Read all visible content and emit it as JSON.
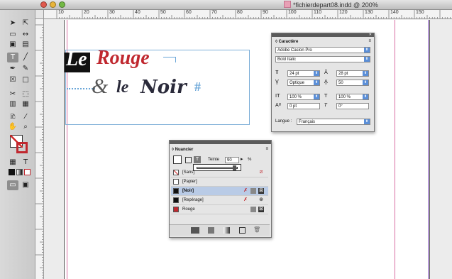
{
  "window": {
    "title": "*fichierdepart08.indd @ 200%"
  },
  "ruler": {
    "top_labels": [
      "10",
      "20",
      "30",
      "40",
      "50",
      "60",
      "70",
      "80",
      "90",
      "100",
      "110",
      "120",
      "130",
      "140",
      "150"
    ]
  },
  "document": {
    "word1": "Le",
    "word2": "Rouge",
    "word3": "&",
    "word4": "le",
    "word5": "Noir",
    "end_marker": "#",
    "red": "#c0282f",
    "dark": "#2a2a3a"
  },
  "caractere_panel": {
    "tab": "◊ Caractère",
    "font_family": "Adobe Caslon Pro",
    "font_style": "Bold Italic",
    "size": "24 pt",
    "leading": "28 pt",
    "kerning": "Optique",
    "tracking": "50",
    "vscale": "100 %",
    "hscale": "100 %",
    "baseline": "0 pt",
    "skew": "0°",
    "language_label": "Langue :",
    "language": "Français"
  },
  "nuancier_panel": {
    "tab": "◊ Nuancier",
    "tint_label": "Teinte",
    "tint_value": "90",
    "tint_unit": "%",
    "swatches": [
      {
        "name": "[Sans]",
        "color": "#ffffff"
      },
      {
        "name": "[Papier]",
        "color": "#ffffff"
      },
      {
        "name": "[Noir]",
        "color": "#111111"
      },
      {
        "name": "[Repérage]",
        "color": "#111111"
      },
      {
        "name": "Rouge",
        "color": "#c0282f"
      }
    ]
  }
}
